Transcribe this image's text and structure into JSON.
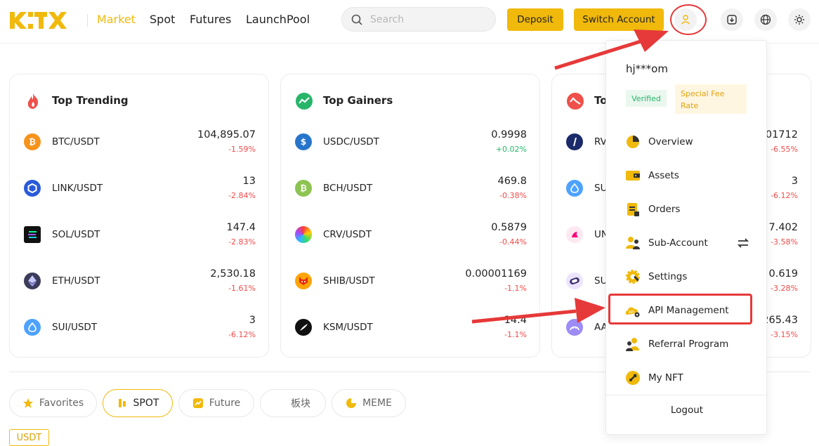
{
  "header": {
    "nav": [
      "Market",
      "Spot",
      "Futures",
      "LaunchPool"
    ],
    "active_nav": "Market",
    "search_placeholder": "Search",
    "deposit_label": "Deposit",
    "switch_account_label": "Switch Account",
    "icons": [
      "user-icon",
      "download-icon",
      "globe-icon",
      "sun-icon"
    ]
  },
  "colors": {
    "accent": "#f0b90b",
    "negative": "#f04b4b",
    "positive": "#27b569",
    "annotation_red": "#e63939"
  },
  "cards": [
    {
      "title": "Top Trending",
      "rows": [
        {
          "pair": "BTC/USDT",
          "price": "104,895.07",
          "change": "-1.59%",
          "dir": "neg",
          "coin": "btc"
        },
        {
          "pair": "LINK/USDT",
          "price": "13",
          "change": "-2.84%",
          "dir": "neg",
          "coin": "link"
        },
        {
          "pair": "SOL/USDT",
          "price": "147.4",
          "change": "-2.83%",
          "dir": "neg",
          "coin": "sol"
        },
        {
          "pair": "ETH/USDT",
          "price": "2,530.18",
          "change": "-1.61%",
          "dir": "neg",
          "coin": "eth"
        },
        {
          "pair": "SUI/USDT",
          "price": "3",
          "change": "-6.12%",
          "dir": "neg",
          "coin": "sui"
        }
      ]
    },
    {
      "title": "Top Gainers",
      "rows": [
        {
          "pair": "USDC/USDT",
          "price": "0.9998",
          "change": "+0.02%",
          "dir": "pos",
          "coin": "usdc"
        },
        {
          "pair": "BCH/USDT",
          "price": "469.8",
          "change": "-0.38%",
          "dir": "neg",
          "coin": "bch"
        },
        {
          "pair": "CRV/USDT",
          "price": "0.5879",
          "change": "-0.44%",
          "dir": "neg",
          "coin": "crv"
        },
        {
          "pair": "SHIB/USDT",
          "price": "0.00001169",
          "change": "-1.1%",
          "dir": "neg",
          "coin": "shib"
        },
        {
          "pair": "KSM/USDT",
          "price": "14.4",
          "change": "-1.1%",
          "dir": "neg",
          "coin": "ksm"
        }
      ]
    },
    {
      "title": "To",
      "rows": [
        {
          "pair": "RV",
          "price": "01712",
          "change": "-6.55%",
          "dir": "neg",
          "coin": "rv"
        },
        {
          "pair": "SU",
          "price": "3",
          "change": "-6.12%",
          "dir": "neg",
          "coin": "sui"
        },
        {
          "pair": "UN",
          "price": "7.402",
          "change": "-3.58%",
          "dir": "neg",
          "coin": "uni"
        },
        {
          "pair": "SU",
          "price": "0.619",
          "change": "-3.28%",
          "dir": "neg",
          "coin": "sushi"
        },
        {
          "pair": "AA",
          "price": "265.43",
          "change": "-3.15%",
          "dir": "neg",
          "coin": "aave"
        }
      ]
    }
  ],
  "tabs": [
    {
      "label": "Favorites",
      "icon": "star-icon",
      "active": false
    },
    {
      "label": "SPOT",
      "icon": "spot-icon",
      "active": true
    },
    {
      "label": "Future",
      "icon": "future-icon",
      "active": false
    },
    {
      "label": "板块",
      "icon": "",
      "active": false
    },
    {
      "label": "MEME",
      "icon": "meme-icon",
      "active": false
    }
  ],
  "quote_tag": "USDT",
  "dropdown": {
    "username": "hj***om",
    "verified_label": "Verified",
    "fee_label": "Special Fee Rate",
    "items": [
      {
        "label": "Overview",
        "icon": "overview-icon"
      },
      {
        "label": "Assets",
        "icon": "wallet-icon"
      },
      {
        "label": "Orders",
        "icon": "orders-icon"
      },
      {
        "label": "Sub-Account",
        "icon": "sub-account-icon"
      },
      {
        "label": "Settings",
        "icon": "settings-icon"
      },
      {
        "label": "API Management",
        "icon": "api-icon"
      },
      {
        "label": "Referral Program",
        "icon": "referral-icon"
      },
      {
        "label": "My NFT",
        "icon": "nft-icon"
      }
    ],
    "logout_label": "Logout"
  }
}
